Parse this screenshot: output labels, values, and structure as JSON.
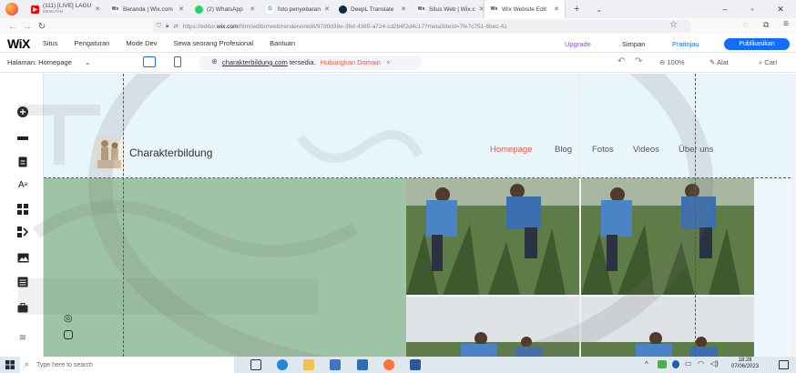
{
  "browser": {
    "tabs": [
      {
        "title": "(111) [LIVE] LAGU",
        "subtitle": "MEMUTAR",
        "icon": "youtube-icon",
        "color": "#ff0000",
        "active": false
      },
      {
        "title": "Beranda | Wix.com",
        "icon": "wix-icon",
        "color": "#222222",
        "active": false
      },
      {
        "title": "(2) WhatsApp",
        "icon": "whatsapp-icon",
        "color": "#25d366",
        "active": false
      },
      {
        "title": "foto penyebaran",
        "icon": "google-icon",
        "color": "#4285f4",
        "active": false
      },
      {
        "title": "DeepL Translate",
        "icon": "deepl-icon",
        "color": "#0f2b46",
        "active": false
      },
      {
        "title": "Situs Web | Wix.c",
        "icon": "wix-icon",
        "color": "#222222",
        "active": false
      },
      {
        "title": "Wix Website Edit",
        "icon": "wix-icon",
        "color": "#222222",
        "active": true
      }
    ],
    "url_prefix": "https://editor.",
    "url_domain": "wix.com",
    "url_rest": "/html/editor/web/renderer/edit/97d0d39e-3fef-4365-a724-cd2b4f2d4c17?metaSiteId=7fe7c751-6bec-41"
  },
  "wix": {
    "logo": "WiX",
    "menu": [
      "Situs",
      "Pengaturan",
      "Mode Dev",
      "Sewa seorang Profesional",
      "Bantuan"
    ],
    "upgrade": "Upgrade",
    "save": "Simpan",
    "preview": "Pratinjau",
    "publish": "Publikasikan",
    "page_label": "Halaman: Homepage",
    "domain_link": "charakterbildung.com",
    "domain_status": "tersedia.",
    "connect_domain": "Hubungkan Domain",
    "zoom": "100%",
    "tools": "Alat",
    "search": "Cari"
  },
  "site": {
    "title": "Charakterbildung",
    "nav": [
      "Homepage",
      "Blog",
      "Fotos",
      "Videos",
      "Über uns"
    ],
    "active_nav": "Homepage"
  },
  "taskbar": {
    "search_placeholder": "Type here to search",
    "time": "18:28",
    "date": "07/06/2023"
  },
  "colors": {
    "accent": "#116dff",
    "nav_active": "#e8584a",
    "hero_green": "#9fc4a5",
    "header_bg": "#e8f6fc",
    "upgrade": "#8a4bff"
  }
}
